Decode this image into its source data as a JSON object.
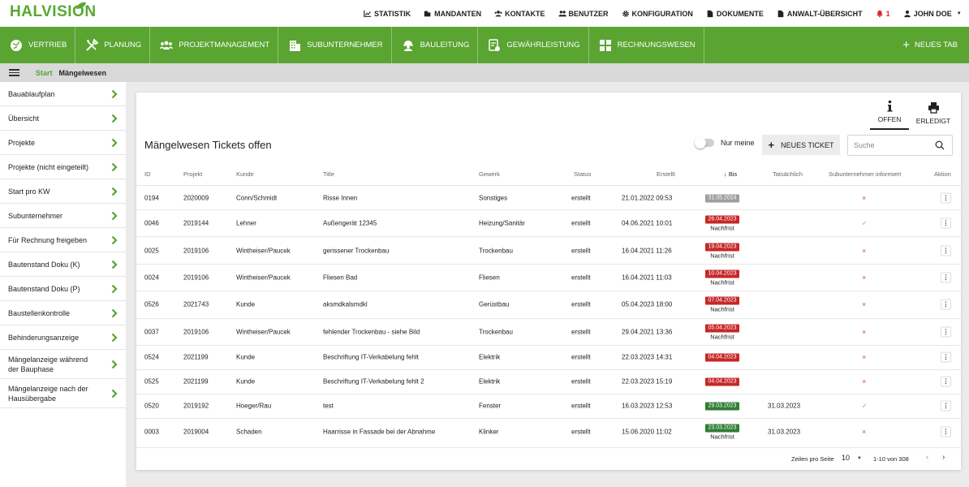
{
  "brand": {
    "logo_text": "HALVISION",
    "accent": "#5aa432",
    "leaf_color": "#58a832"
  },
  "topnav": [
    {
      "label": "STATISTIK",
      "icon": "chart-icon"
    },
    {
      "label": "MANDANTEN",
      "icon": "building-icon"
    },
    {
      "label": "KONTAKTE",
      "icon": "contacts-icon"
    },
    {
      "label": "BENUTZER",
      "icon": "users-icon"
    },
    {
      "label": "KONFIGURATION",
      "icon": "gear-icon"
    },
    {
      "label": "DOKUMENTE",
      "icon": "document-icon"
    },
    {
      "label": "ANWALT-ÜBERSICHT",
      "icon": "document-icon"
    },
    {
      "label": "1",
      "icon": "bell-icon"
    },
    {
      "label": "JOHN DOE",
      "icon": "user-icon"
    }
  ],
  "mainnav": [
    {
      "label": "VERTRIEB",
      "icon": "globe-icon"
    },
    {
      "label": "PLANUNG",
      "icon": "tools-icon"
    },
    {
      "label": "PROJEKTMANAGEMENT",
      "icon": "team-icon"
    },
    {
      "label": "SUBUNTERNEHMER",
      "icon": "building-icon"
    },
    {
      "label": "BAULEITUNG",
      "icon": "worker-icon"
    },
    {
      "label": "GEWÄHRLEISTUNG",
      "icon": "certificate-icon"
    },
    {
      "label": "RECHNUNGSWESEN",
      "icon": "grid-icon"
    }
  ],
  "new_tab_label": "NEUES TAB",
  "breadcrumb": {
    "start": "Start",
    "current": "Mängelwesen"
  },
  "sidebar": [
    {
      "label": "Bauablaufplan"
    },
    {
      "label": "Übersicht"
    },
    {
      "label": "Projekte"
    },
    {
      "label": "Projekte (nicht eingeteilt)"
    },
    {
      "label": "Start pro KW"
    },
    {
      "label": "Subunternehmer"
    },
    {
      "label": "Für Rechnung freigeben"
    },
    {
      "label": "Bautenstand Doku (K)"
    },
    {
      "label": "Bautenstand Doku (P)"
    },
    {
      "label": "Baustellenkontrolle"
    },
    {
      "label": "Behinderungsanzeige"
    },
    {
      "label": "Mängelanzeige während der Bauphase"
    },
    {
      "label": "Mängelanzeige nach der Hausübergabe"
    }
  ],
  "tabs": [
    {
      "label": "OFFEN",
      "icon": "info-icon",
      "active": true
    },
    {
      "label": "ERLEDIGT",
      "icon": "printer-icon",
      "active": false
    }
  ],
  "card_title": "Mängelwesen Tickets offen",
  "toggle_label": "Nur meine",
  "new_ticket_label": "NEUES TICKET",
  "search_placeholder": "Suche",
  "columns": {
    "id": "ID",
    "projekt": "Projekt",
    "kunde": "Kunde",
    "title": "Title",
    "gewerk": "Gewerk",
    "status": "Status",
    "erstellt": "Erstellt",
    "bis": "Bis",
    "tats": "Tatsächlich",
    "sub": "Subunternehmer informiert",
    "aktion": "Aktion"
  },
  "badge_colors": {
    "grey": "#9e9e9e",
    "red": "#c62828",
    "green": "#2e7d32"
  },
  "rows": [
    {
      "id": "0194",
      "projekt": "2020009",
      "kunde": "Conn/Schmidt",
      "title": "Risse Innen",
      "gewerk": "Sonstiges",
      "status": "erstellt",
      "erstellt": "21.01.2022 09:53",
      "bis": "31.05.2024",
      "bis_color": "grey",
      "nachfrist": "",
      "tats": "",
      "informed": false
    },
    {
      "id": "0046",
      "projekt": "2019144",
      "kunde": "Lehner",
      "title": "Außengerät 12345",
      "gewerk": "Heizung/Sanitär",
      "status": "erstellt",
      "erstellt": "04.06.2021 10:01",
      "bis": "26.04.2023",
      "bis_color": "red",
      "nachfrist": "Nachfrist",
      "tats": "",
      "informed": true
    },
    {
      "id": "0025",
      "projekt": "2019106",
      "kunde": "Wintheiser/Paucek",
      "title": "gerissener Trockenbau",
      "gewerk": "Trockenbau",
      "status": "erstellt",
      "erstellt": "16.04.2021 11:26",
      "bis": "19.04.2023",
      "bis_color": "red",
      "nachfrist": "Nachfrist",
      "tats": "",
      "informed": false
    },
    {
      "id": "0024",
      "projekt": "2019106",
      "kunde": "Wintheiser/Paucek",
      "title": "Fliesen Bad",
      "gewerk": "Fliesen",
      "status": "erstellt",
      "erstellt": "16.04.2021 11:03",
      "bis": "10.04.2023",
      "bis_color": "red",
      "nachfrist": "Nachfrist",
      "tats": "",
      "informed": false
    },
    {
      "id": "0526",
      "projekt": "2021743",
      "kunde": "Kunde",
      "title": "aksmdkalsmdkl",
      "gewerk": "Gerüstbau",
      "status": "erstellt",
      "erstellt": "05.04.2023 18:00",
      "bis": "07.04.2023",
      "bis_color": "red",
      "nachfrist": "Nachfrist",
      "tats": "",
      "informed": false
    },
    {
      "id": "0037",
      "projekt": "2019106",
      "kunde": "Wintheiser/Paucek",
      "title": "fehlender Trockenbau - siehe Bild",
      "gewerk": "Trockenbau",
      "status": "erstellt",
      "erstellt": "29.04.2021 13:36",
      "bis": "05.04.2023",
      "bis_color": "red",
      "nachfrist": "Nachfrist",
      "tats": "",
      "informed": false
    },
    {
      "id": "0524",
      "projekt": "2021199",
      "kunde": "Kunde",
      "title": "Beschriftung IT-Verkabelung fehlt",
      "gewerk": "Elektrik",
      "status": "erstellt",
      "erstellt": "22.03.2023 14:31",
      "bis": "04.04.2023",
      "bis_color": "red",
      "nachfrist": "",
      "tats": "",
      "informed": false
    },
    {
      "id": "0525",
      "projekt": "2021199",
      "kunde": "Kunde",
      "title": "Beschriftung IT-Verkabelung fehlt 2",
      "gewerk": "Elektrik",
      "status": "erstellt",
      "erstellt": "22.03.2023 15:19",
      "bis": "04.04.2023",
      "bis_color": "red",
      "nachfrist": "",
      "tats": "",
      "informed": false
    },
    {
      "id": "0520",
      "projekt": "2019192",
      "kunde": "Hoeger/Rau",
      "title": "test",
      "gewerk": "Fenster",
      "status": "erstellt",
      "erstellt": "16.03.2023 12:53",
      "bis": "29.03.2023",
      "bis_color": "green",
      "nachfrist": "",
      "tats": "31.03.2023",
      "informed": true
    },
    {
      "id": "0003",
      "projekt": "2019004",
      "kunde": "Schaden",
      "title": "Haarrisse in Fassade bei der Abnahme",
      "gewerk": "Klinker",
      "status": "erstellt",
      "erstellt": "15.06.2020 11:02",
      "bis": "23.03.2023",
      "bis_color": "green",
      "nachfrist": "Nachfrist",
      "tats": "31.03.2023",
      "informed": false
    }
  ],
  "footer": {
    "rows_per_page_label": "Zeilen pro Seite",
    "rows_per_page": "10",
    "range": "1-10 von 308"
  },
  "actions": {
    "kebab": "⋮",
    "prev": "‹",
    "next": "›",
    "x": "×",
    "check": "✓"
  }
}
